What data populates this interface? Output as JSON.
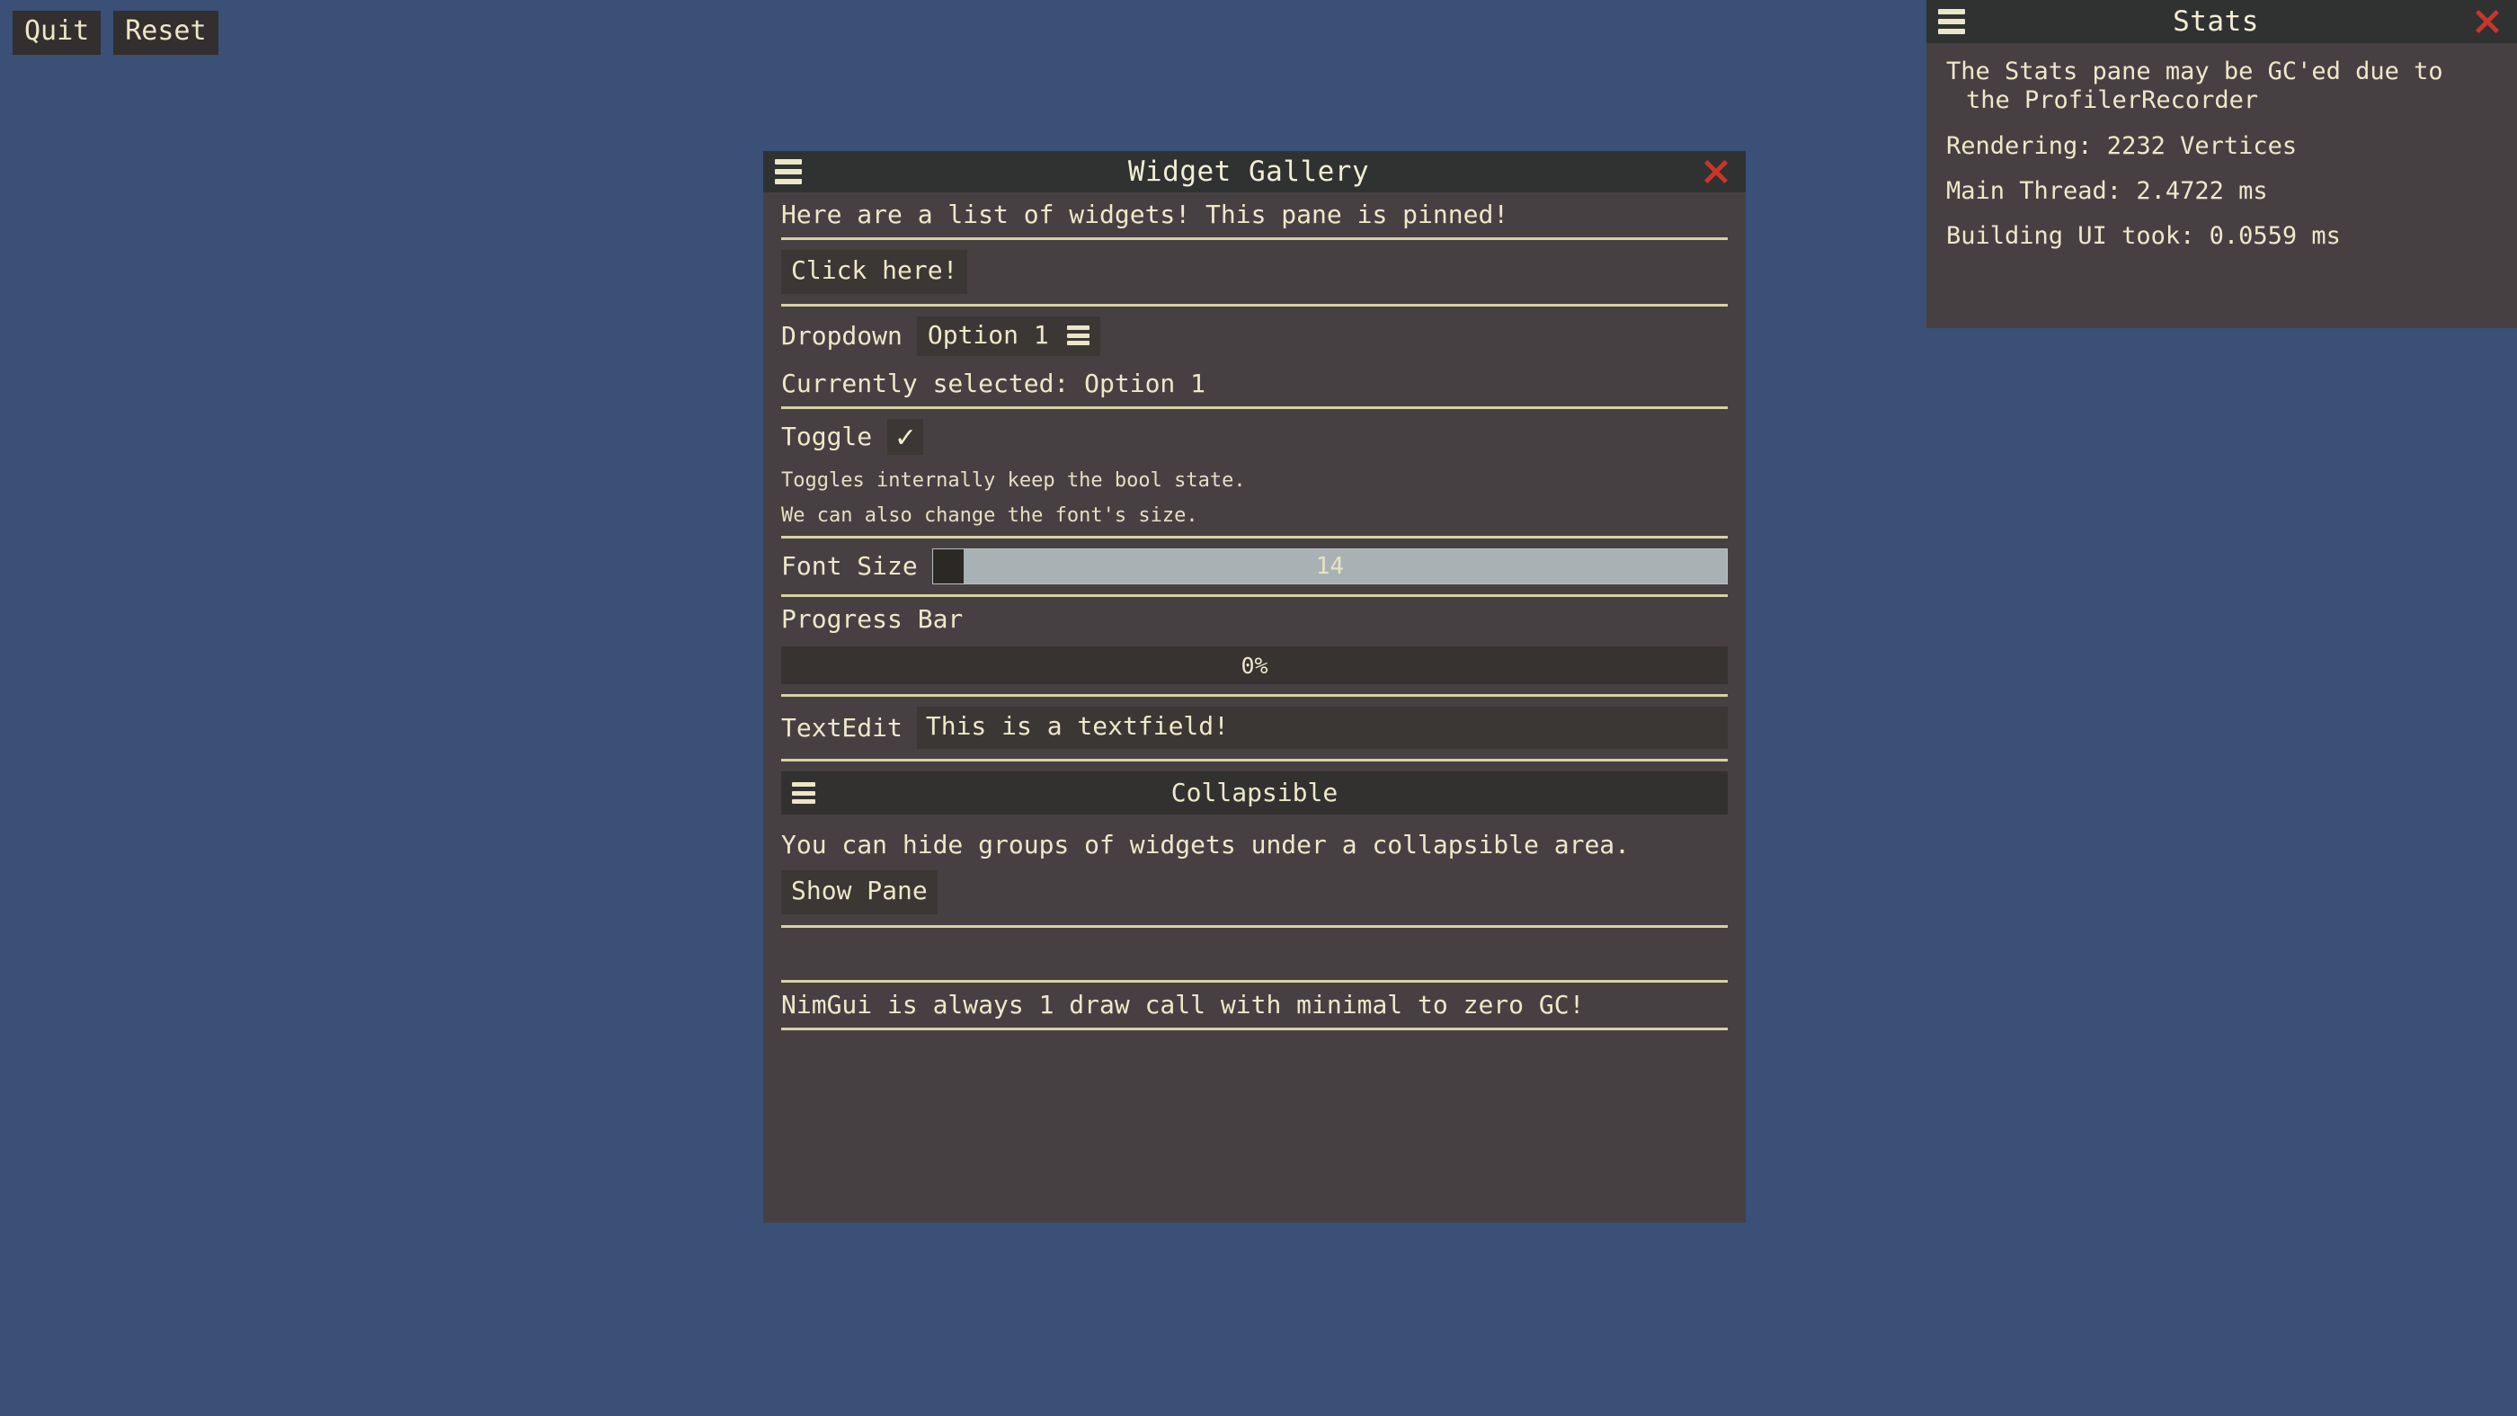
{
  "desktop": {
    "background_color": "#3a5077"
  },
  "toolbar": {
    "quit_label": "Quit",
    "reset_label": "Reset"
  },
  "widget_gallery": {
    "title": "Widget Gallery",
    "menu_icon": "hamburger-icon",
    "close_icon": "close-icon",
    "intro_text": "Here are a list of widgets!  This pane is pinned!",
    "click_button_label": "Click here!",
    "dropdown_label": "Dropdown",
    "dropdown_value": "Option 1",
    "dropdown_icon": "hamburger-icon",
    "selected_text": "Currently selected: Option 1",
    "toggle_label": "Toggle",
    "toggle_checked_glyph": "✓",
    "toggle_note_1": "Toggles internally keep the bool state.",
    "toggle_note_2": "We can also change the font's size.",
    "font_size_label": "Font Size",
    "font_size_value": "14",
    "font_size_fill_percent": 0,
    "progress_label": "Progress Bar",
    "progress_value": "0%",
    "progress_percent": 0,
    "textedit_label": "TextEdit",
    "textedit_value": "This is a textfield!",
    "collapsible_title": "Collapsible",
    "collapsible_icon": "hamburger-icon",
    "collapsible_body_text": "You can hide groups of widgets under a collapsible area.",
    "show_pane_label": "Show Pane",
    "footer_text": "NimGui is always 1 draw call with minimal to zero GC!"
  },
  "stats": {
    "title": "Stats",
    "menu_icon": "hamburger-icon",
    "close_icon": "close-icon",
    "note_line_1": "The Stats pane may be GC'ed due to",
    "note_line_2": "the ProfilerRecorder",
    "rendering": "Rendering: 2232 Vertices",
    "main_thread": "Main Thread: 2.4722 ms",
    "building_ui": "Building UI took: 0.0559 ms"
  }
}
